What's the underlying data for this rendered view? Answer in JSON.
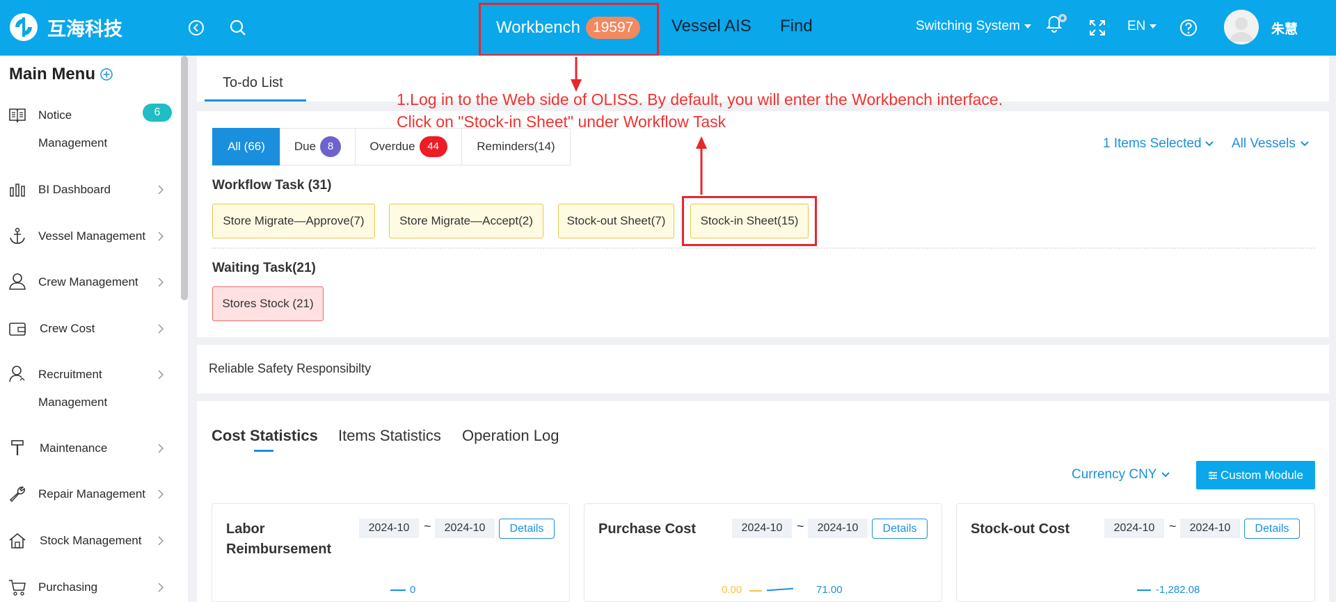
{
  "brand": {
    "name": "互海科技",
    "color": "#0aa7ea"
  },
  "header": {
    "nav": [
      {
        "label": "Workbench",
        "badge": "19597"
      },
      {
        "label": "Vessel AIS"
      },
      {
        "label": "Find"
      }
    ],
    "switching_system": "Switching System",
    "language": "EN",
    "username": "朱慧"
  },
  "sidebar": {
    "title": "Main Menu",
    "notice_badge": "6",
    "items": [
      {
        "label": "Notice",
        "label2": "Management",
        "icon": "book-icon"
      },
      {
        "label": "BI Dashboard",
        "icon": "bar-chart-icon"
      },
      {
        "label": "Vessel Management",
        "icon": "anchor-icon"
      },
      {
        "label": "Crew Management",
        "icon": "user-icon"
      },
      {
        "label": "Crew Cost",
        "icon": "wallet-icon"
      },
      {
        "label": "Recruitment",
        "label2": "Management",
        "icon": "recruit-icon"
      },
      {
        "label": "Maintenance",
        "icon": "hammer-icon"
      },
      {
        "label": "Repair Management",
        "icon": "wrench-icon"
      },
      {
        "label": "Stock Management",
        "icon": "home-icon"
      },
      {
        "label": "Purchasing",
        "icon": "cart-icon"
      }
    ]
  },
  "todo": {
    "tab": "To-do List",
    "filters": [
      {
        "label": "All (66)"
      },
      {
        "label": "Due",
        "badge": "8"
      },
      {
        "label": "Overdue",
        "badge": "44"
      },
      {
        "label": "Reminders(14)"
      }
    ],
    "items_selected": "1 Items Selected",
    "all_vessels": "All Vessels",
    "workflow_title": "Workflow Task (31)",
    "workflow_tasks": [
      "Store Migrate—Approve(7)",
      "Store Migrate—Accept(2)",
      "Stock-out Sheet(7)",
      "Stock-in Sheet(15)"
    ],
    "waiting_title": "Waiting Task(21)",
    "waiting_tasks": [
      "Stores Stock (21)"
    ]
  },
  "annotation": {
    "line1": "1.Log in to the Web side of OLISS. By default, you will enter the Workbench interface.",
    "line2": "Click on \"Stock-in Sheet\" under Workflow Task"
  },
  "slogan": "Reliable Safety Responsibilty",
  "stats": {
    "tabs": [
      "Cost Statistics",
      "Items Statistics",
      "Operation Log"
    ],
    "currency": "Currency CNY",
    "custom_module": "Custom Module",
    "cards": [
      {
        "title": "Labor Reimbursement",
        "from": "2024-10",
        "to": "2024-10",
        "details": "Details",
        "values": [
          "0"
        ]
      },
      {
        "title": "Purchase Cost",
        "from": "2024-10",
        "to": "2024-10",
        "details": "Details",
        "values": [
          "0.00",
          "71.00"
        ]
      },
      {
        "title": "Stock-out Cost",
        "from": "2024-10",
        "to": "2024-10",
        "details": "Details",
        "values": [
          "-1,282.08"
        ]
      }
    ]
  }
}
